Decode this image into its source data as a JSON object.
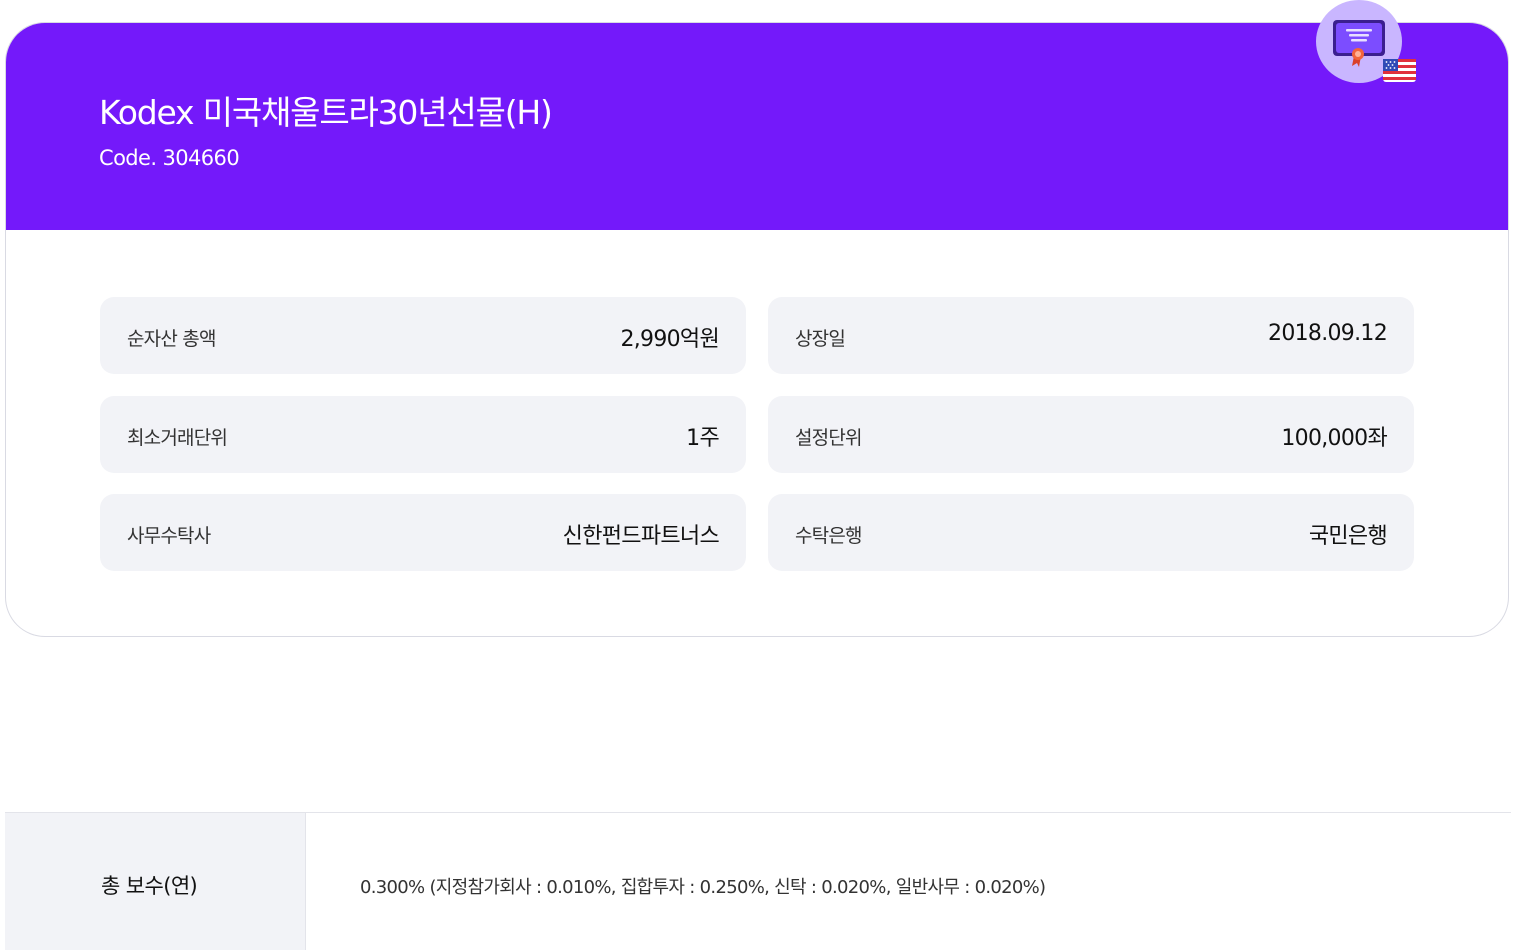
{
  "fund": {
    "title": "Kodex 미국채울트라30년선물(H)",
    "code": "Code. 304660",
    "badge_icon": "certificate-icon",
    "country_flag": "us-flag-icon"
  },
  "info": [
    {
      "label": "순자산 총액",
      "value": "2,990억원"
    },
    {
      "label": "상장일",
      "value": "2018.09.12"
    },
    {
      "label": "최소거래단위",
      "value": "1주"
    },
    {
      "label": "설정단위",
      "value": "100,000좌"
    },
    {
      "label": "사무수탁사",
      "value": "신한펀드파트너스"
    },
    {
      "label": "수탁은행",
      "value": "국민은행"
    }
  ],
  "fees": {
    "label": "총 보수(연)",
    "value": "0.300% (지정참가회사 : 0.010%, 집합투자 : 0.250%, 신탁 : 0.020%, 일반사무 : 0.020%)"
  },
  "colors": {
    "header_bg": "#7419fa",
    "box_bg": "#f2f3f7",
    "badge_bg": "#c9b6ff"
  }
}
